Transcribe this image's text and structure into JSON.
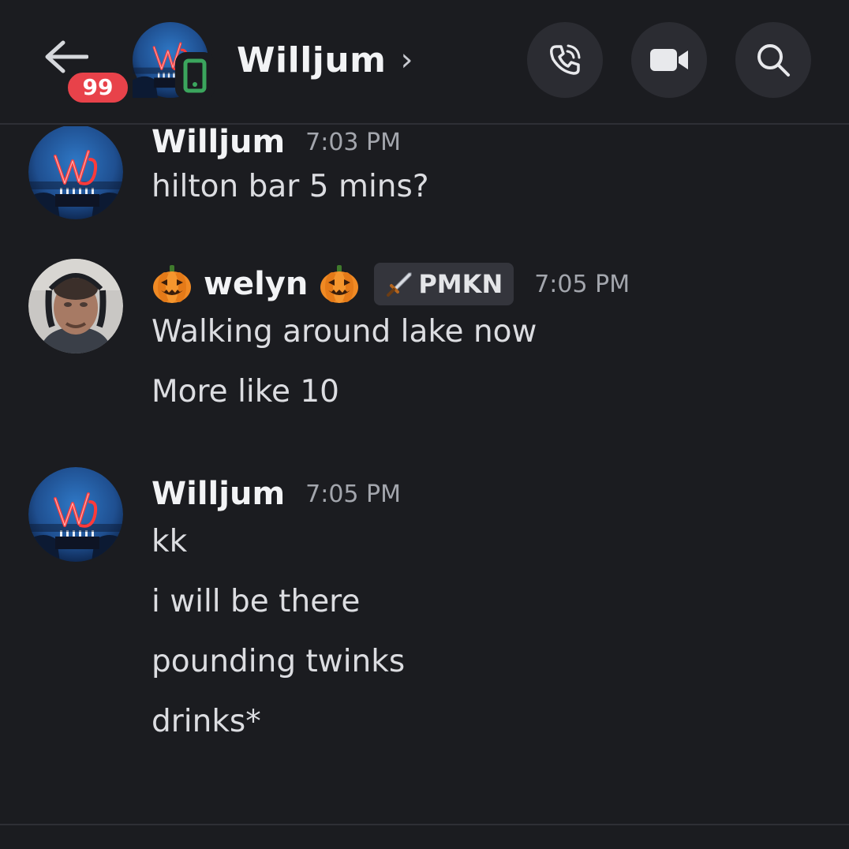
{
  "header": {
    "back_icon": "arrow-left-icon",
    "unread_badge": "99",
    "avatar_icon": "neon-w-avatar",
    "status_icon": "mobile-phone-icon",
    "title": "Willjum",
    "title_chevron": "›",
    "actions": [
      {
        "name": "voice-call",
        "icon": "phone-icon"
      },
      {
        "name": "video-call",
        "icon": "video-camera-icon"
      },
      {
        "name": "search",
        "icon": "search-icon"
      }
    ]
  },
  "messages": [
    {
      "author": "Willjum",
      "time": "7:03 PM",
      "lines": [
        "hilton bar 5 mins?"
      ]
    },
    {
      "author": "welyn",
      "author_emoji": "jack-o-lantern-icon",
      "tag_icon": "sword-icon",
      "tag": "PMKN",
      "time": "7:05 PM",
      "lines": [
        "Walking around lake now",
        "More like 10"
      ]
    },
    {
      "author": "Willjum",
      "time": "7:05 PM",
      "lines": [
        "kk",
        "i will be there",
        "pounding twinks",
        "drinks*"
      ]
    }
  ],
  "colors": {
    "background": "#1b1c20",
    "badge": "#e8424a",
    "online_mobile": "#3ba55d",
    "button_bg": "#2b2c32",
    "timestamp": "#a3a6ad"
  }
}
